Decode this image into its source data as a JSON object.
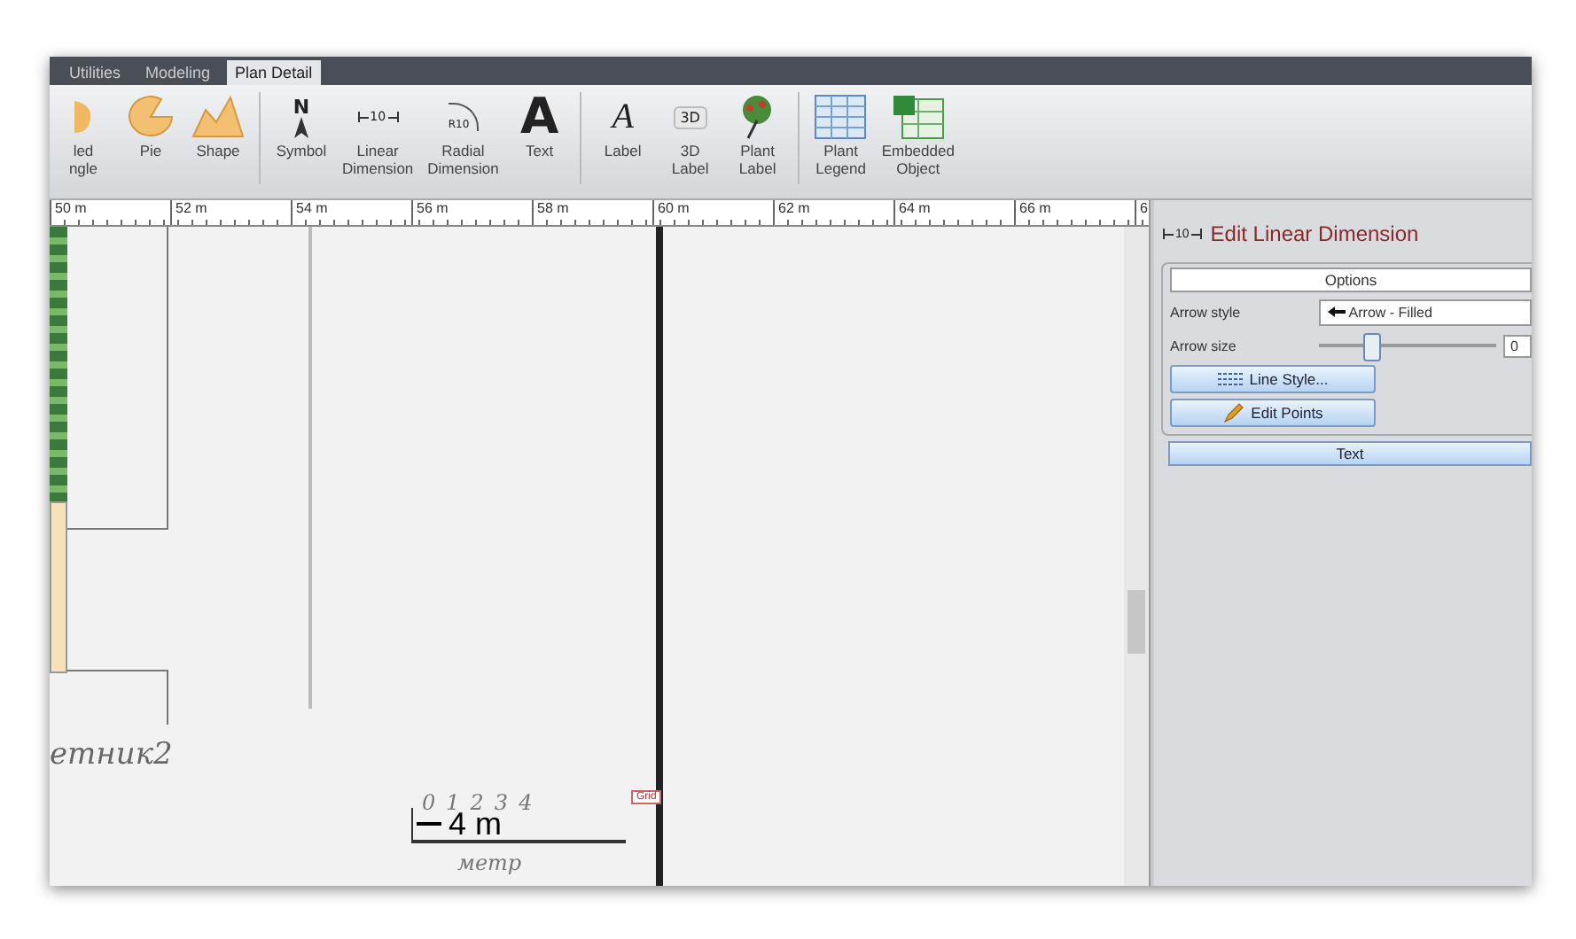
{
  "tabs": [
    {
      "label": "Utilities",
      "selected": false
    },
    {
      "label": "Modeling",
      "selected": false
    },
    {
      "label": "Plan Detail",
      "selected": true
    }
  ],
  "ribbon": {
    "groups": [
      [
        {
          "kind": "cut",
          "lines": [
            "led",
            "ngle"
          ]
        },
        {
          "kind": "pie",
          "lines": [
            "Pie"
          ]
        },
        {
          "kind": "shape",
          "lines": [
            "Shape"
          ]
        }
      ],
      [
        {
          "kind": "symbol",
          "icon_text": "N",
          "lines": [
            "Symbol"
          ]
        },
        {
          "kind": "linear",
          "icon_text": "10",
          "lines": [
            "Linear",
            "Dimension"
          ]
        },
        {
          "kind": "radial",
          "icon_text": "R10",
          "lines": [
            "Radial",
            "Dimension"
          ]
        },
        {
          "kind": "text",
          "icon_text": "A",
          "lines": [
            "Text"
          ]
        }
      ],
      [
        {
          "kind": "label",
          "icon_text": "A",
          "lines": [
            "Label"
          ]
        },
        {
          "kind": "label3d",
          "icon_text": "3D",
          "lines": [
            "3D",
            "Label"
          ]
        },
        {
          "kind": "plant",
          "lines": [
            "Plant",
            "Label"
          ]
        }
      ],
      [
        {
          "kind": "legend",
          "lines": [
            "Plant",
            "Legend"
          ]
        },
        {
          "kind": "embedded",
          "lines": [
            "Embedded",
            "Object"
          ]
        }
      ]
    ]
  },
  "ruler": [
    "50 m",
    "52 m",
    "54 m",
    "56 m",
    "58 m",
    "60 m",
    "62 m",
    "64 m",
    "66 m",
    "6"
  ],
  "canvas": {
    "bed_label": "етник2",
    "scale_numbers": [
      "0",
      "1",
      "2",
      "3",
      "4"
    ],
    "scale_length": "4 m",
    "scale_unit": "метр",
    "grid_tag": "Grid"
  },
  "panel": {
    "icon_text": "10",
    "title": "Edit Linear Dimension",
    "options_header": "Options",
    "arrow_style_label": "Arrow style",
    "arrow_style_value": "Arrow - Filled",
    "arrow_size_label": "Arrow size",
    "arrow_size": {
      "level": 0.3
    },
    "arrow_size_value": "0",
    "buttons": [
      {
        "kind": "line",
        "label": "Line Style..."
      },
      {
        "kind": "edit",
        "label": "Edit Points"
      }
    ],
    "text_header": "Text"
  }
}
